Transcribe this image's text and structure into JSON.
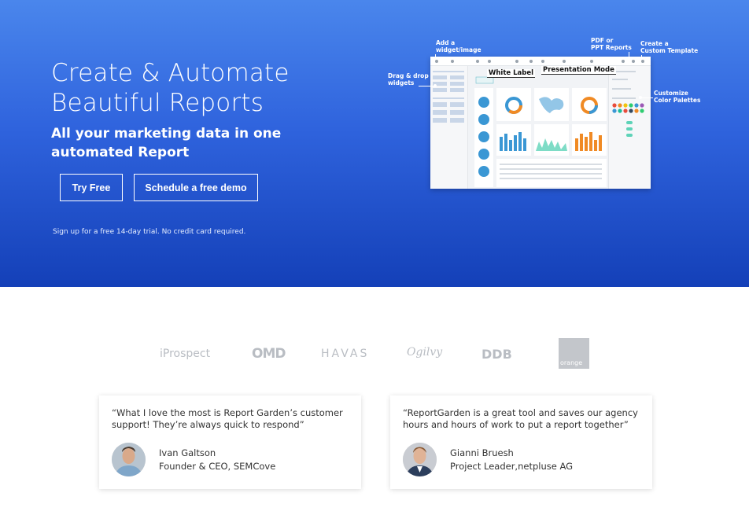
{
  "hero": {
    "title_line1": "Create & Automate",
    "title_line2": "Beautiful Reports",
    "subtitle": "All your marketing data in one automated Report",
    "try_free_label": "Try Free",
    "demo_label": "Schedule a free demo",
    "note": "Sign up for a free 14-day trial. No credit card required."
  },
  "mockup": {
    "annotations": {
      "add_widget": "Add a\nwidget/image",
      "drag_drop": "Drag & drop\nwidgets",
      "pdf_ppt": "PDF or\nPPT Reports",
      "create_template": "Create a\nCustom Template",
      "customize_colors": "Customize\nColor Palettes",
      "white_label": "White Label",
      "presentation_mode": "Presentation Mode"
    }
  },
  "logos": {
    "iprospect": "iProspect",
    "omd": "OMD",
    "havas": "HAVAS",
    "ogilvy": "Ogilvy",
    "ddb": "DDB",
    "orange": "orange"
  },
  "testimonials": [
    {
      "quote": "“What I love the most is Report Garden’s customer support! They’re always quick to respond”",
      "name": "Ivan Galtson",
      "role": "Founder & CEO, SEMCove"
    },
    {
      "quote": "“ReportGarden is a great tool and saves our agency hours and hours of work to put a report together”",
      "name": "Gianni Bruesh",
      "role": "Project Leader,netpluse AG"
    }
  ],
  "colors": {
    "hero_top": "#4a86ec",
    "hero_bottom": "#1440b8",
    "logo_gray": "#b9bdc3"
  }
}
